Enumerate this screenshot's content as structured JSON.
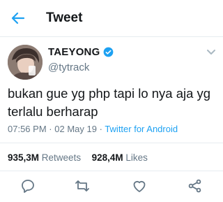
{
  "header": {
    "title": "Tweet",
    "back_icon": "arrow-left-icon",
    "accent": "#1da1f2"
  },
  "author": {
    "name": "TAEYONG",
    "handle": "@tytrack",
    "verified": true
  },
  "tweet": {
    "text": "bukan gue yg php tapi lo nya aja yg terlalu berharap",
    "time": "07:56 PM",
    "date": "02 May 19",
    "separator": "·",
    "client": "Twitter for Android"
  },
  "stats": {
    "retweets_count": "935,3M",
    "retweets_label": "Retweets",
    "likes_count": "928,4M",
    "likes_label": "Likes"
  },
  "actions": [
    "reply-icon",
    "retweet-icon",
    "like-icon",
    "share-icon"
  ]
}
